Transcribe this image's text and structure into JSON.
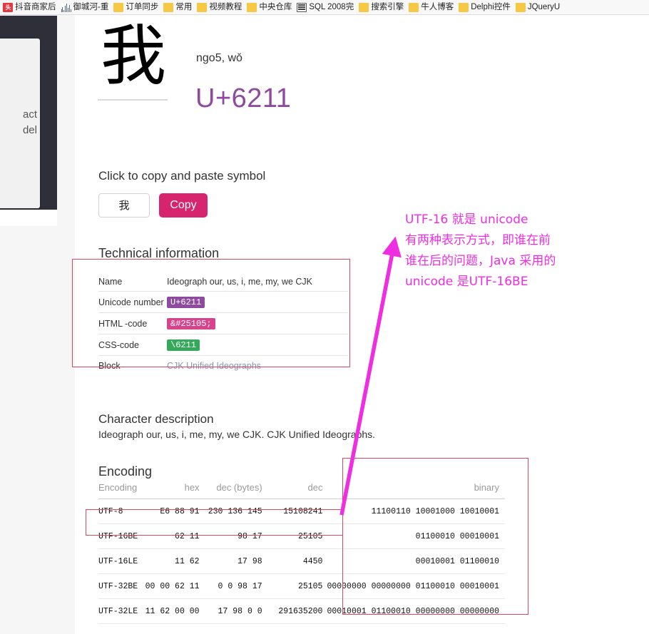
{
  "bookmarks": [
    {
      "label": "抖音商家后",
      "icon": "toutiao-icon"
    },
    {
      "label": "御城河-重",
      "icon": "waveform-icon"
    },
    {
      "label": "订单同步",
      "icon": "folder-icon"
    },
    {
      "label": "常用",
      "icon": "folder-icon"
    },
    {
      "label": "视频教程",
      "icon": "folder-icon"
    },
    {
      "label": "中央仓库",
      "icon": "folder-icon"
    },
    {
      "label": "SQL 2008完",
      "icon": "document-icon"
    },
    {
      "label": "搜索引擎",
      "icon": "folder-icon"
    },
    {
      "label": "牛人博客",
      "icon": "folder-icon"
    },
    {
      "label": "Delphi控件",
      "icon": "folder-icon"
    },
    {
      "label": "JQueryU",
      "icon": "folder-icon"
    }
  ],
  "left_panel": {
    "card_text": "act\ndel"
  },
  "header": {
    "glyph": "我",
    "readings": "ngo5, wǒ",
    "codepoint": "U+6211"
  },
  "copy_block": {
    "heading": "Click to copy and paste symbol",
    "symbol_value": "我",
    "copy_label": "Copy"
  },
  "technical": {
    "heading": "Technical information",
    "rows": [
      {
        "key": "Name",
        "value": "Ideograph our, us, i, me, my, we CJK",
        "style": "plain"
      },
      {
        "key": "Unicode number",
        "value": "U+6211",
        "style": "purple"
      },
      {
        "key": "HTML -code",
        "value": "&#25105;",
        "style": "pink"
      },
      {
        "key": "CSS-code",
        "value": "\\6211",
        "style": "green"
      },
      {
        "key": "Block",
        "value": "CJK Unified Ideographs",
        "style": "link"
      }
    ]
  },
  "description": {
    "heading": "Character description",
    "text": "Ideograph our, us, i, me, my, we CJK. CJK Unified Ideographs."
  },
  "encoding": {
    "heading": "Encoding",
    "columns": [
      "Encoding",
      "hex",
      "dec (bytes)",
      "dec",
      "binary"
    ],
    "rows": [
      {
        "name": "UTF-8",
        "hex": "E6 88 91",
        "dec_bytes": "230 136 145",
        "dec": "15108241",
        "binary": "11100110 10001000 10010001"
      },
      {
        "name": "UTF-16BE",
        "hex": "62 11",
        "dec_bytes": "98 17",
        "dec": "25105",
        "binary": "01100010 00010001"
      },
      {
        "name": "UTF-16LE",
        "hex": "11 62",
        "dec_bytes": "17 98",
        "dec": "4450",
        "binary": "00010001 01100010"
      },
      {
        "name": "UTF-32BE",
        "hex": "00 00 62 11",
        "dec_bytes": "0 0 98 17",
        "dec": "25105",
        "binary": "00000000 00000000 01100010 00010001"
      },
      {
        "name": "UTF-32LE",
        "hex": "11 62 00 00",
        "dec_bytes": "17 98 0 0",
        "dec": "291635200",
        "binary": "00010001 01100010 00000000 00000000"
      }
    ]
  },
  "annotation": {
    "text": "UTF-16 就是 unicode\n有两种表示方式，即谁在前\n谁在后的问题，Java 采用的\nunicode 是UTF-16BE",
    "color": "#ee2ee0",
    "box_color": "#e0475c"
  },
  "colors": {
    "accent_purple": "#8e4a9e",
    "copy_pink": "#d6246e",
    "chip_pink": "#d6448e",
    "chip_green": "#35a85b",
    "annotation_magenta": "#ee2ee0",
    "redbox": "#e0475c"
  }
}
